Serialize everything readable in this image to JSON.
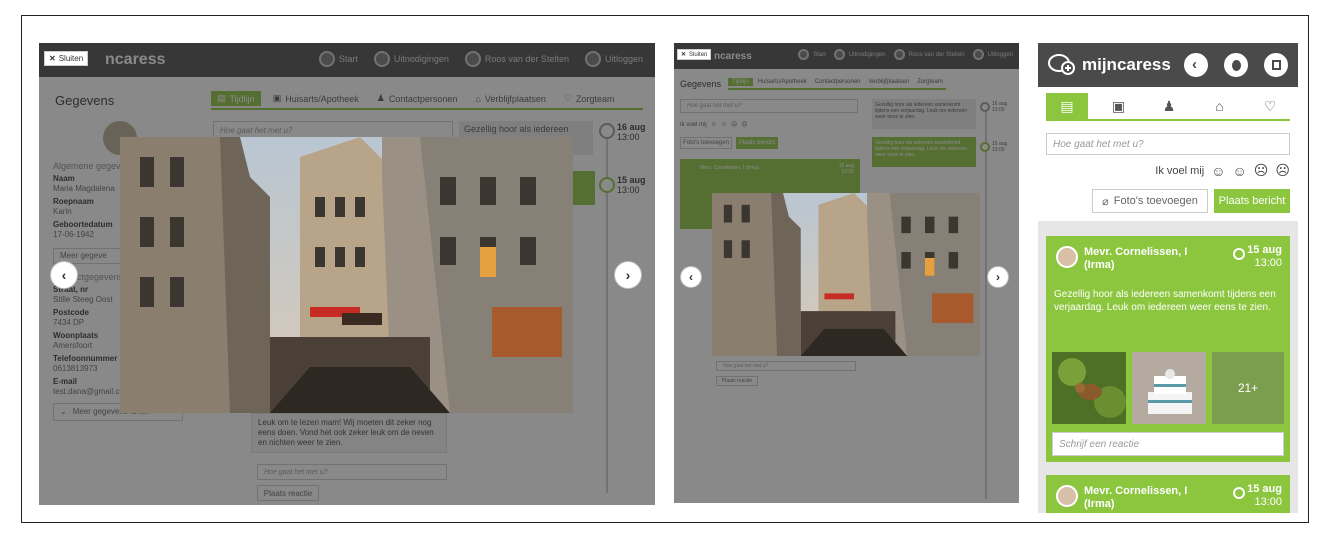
{
  "desktop": {
    "close_label": "Sluiten",
    "logo_fragment": "ncaress",
    "nav": [
      {
        "label": "Start",
        "icon": "back-icon"
      },
      {
        "label": "Uitnodigingen",
        "icon": "invite-icon"
      },
      {
        "label": "Roos van der Stelten",
        "icon": "user-icon"
      },
      {
        "label": "Uitloggen",
        "icon": "logout-icon"
      }
    ],
    "section_title": "Gegevens",
    "tabs": [
      {
        "label": "Tijdlijn",
        "icon": "timeline-icon",
        "active": true
      },
      {
        "label": "Huisarts/Apotheek",
        "icon": "hospital-icon",
        "active": false
      },
      {
        "label": "Contactpersonen",
        "icon": "contacts-icon",
        "active": false
      },
      {
        "label": "Verblijfplaatsen",
        "icon": "house-icon",
        "active": false
      },
      {
        "label": "Zorgteam",
        "icon": "team-icon",
        "active": false
      }
    ],
    "post_placeholder": "Hoe gaat het met u?",
    "timeline_bubble_1": "Gezellig hoor als iedereen",
    "timeline_date_1": {
      "day": "16 aug",
      "time": "13:00"
    },
    "timeline_date_2": {
      "day": "15 aug",
      "time": "13:00"
    },
    "profile": {
      "general_heading": "Algemene gegev",
      "fields": [
        {
          "label": "Naam",
          "value": "Maria Magdalena"
        },
        {
          "label": "Roepnaam",
          "value": "Karin"
        },
        {
          "label": "Geboortedatum",
          "value": "17-06-1942"
        }
      ],
      "more_button_fragment": "Meer gegeve",
      "contact_heading": "Contactgegevens",
      "contact_fields": [
        {
          "label": "Straat, nr",
          "value": "Stille Steeg Oost"
        },
        {
          "label": "Postcode",
          "value": "7434 DP"
        },
        {
          "label": "Woonplaats",
          "value": "Amersfoort"
        },
        {
          "label": "Telefoonnummer",
          "value": "0613813973"
        },
        {
          "label": "E-mail",
          "value": "test.dana@gmail.com"
        }
      ],
      "show_more_button": "Meer gegevens tonen"
    },
    "comment_text": "Leuk om te lezen mam! Wij moeten dit zeker nog eens doen. Vond het ook zeker leuk om de neven en nichten weer te zien.",
    "reply_placeholder": "Hoe gaat het met u?",
    "reply_button": "Plaats reactie"
  },
  "tablet": {
    "close_label": "Sluiten",
    "logo_fragment": "ncaress",
    "nav": [
      {
        "label": "Start"
      },
      {
        "label": "Uitnodigingen"
      },
      {
        "label": "Roos van der Stelten"
      },
      {
        "label": "Uitloggen"
      }
    ],
    "section_title": "Gegevens",
    "tabs": [
      {
        "label": "Tijdlijn",
        "active": true
      },
      {
        "label": "Huisarts/Apotheek",
        "active": false
      },
      {
        "label": "Contactpersonen",
        "active": false
      },
      {
        "label": "Verblijfplaatsen",
        "active": false
      },
      {
        "label": "Zorgteam",
        "active": false
      }
    ],
    "post_placeholder": "Hoe gaat het met u?",
    "feel_label": "Ik voel mij",
    "photo_button": "Foto's toevoegen",
    "post_button": "Plaats bericht",
    "post_author": "Mevr. Cornelissen, I (Irma)",
    "post_date": {
      "day": "15 aug",
      "time": "13:00"
    },
    "bubble_1": "Gezellig hoor als iedereen samenkomt tijdens een verjaardag. Leuk om iedereen weer eens te zien.",
    "bubble_2": "Gezellig hoor als iedereen samenkomt tijdens een verjaardag. Leuk om iedereen weer eens te zien.",
    "timeline_dates": [
      {
        "day": "16 aug",
        "time": "13:00"
      },
      {
        "day": "15 aug",
        "time": "13:00"
      }
    ],
    "reply_placeholder": "Hoe gaat het met u?",
    "reply_button": "Plaats reactie"
  },
  "mobile": {
    "logo": "mijncaress",
    "post_placeholder": "Hoe gaat het met u?",
    "feel_label": "Ik voel mij",
    "photo_button": "Foto's toevoegen",
    "post_button": "Plaats bericht",
    "post": {
      "author_line1": "Mevr. Cornelissen, I",
      "author_line2": "(Irma)",
      "day": "15 aug",
      "time": "13:00",
      "text": "Gezellig hoor als iedereen samenkomt tijdens een verjaardag. Leuk om iedereen weer eens te zien.",
      "more_photos": "21+",
      "reply_placeholder": "Schrijf een reactie"
    },
    "post2": {
      "author_line1": "Mevr. Cornelissen, I",
      "author_line2": "(Irma)",
      "day": "15 aug",
      "time": "13:00"
    }
  },
  "colors": {
    "accent": "#8cc63f",
    "topbar": "#4a4a4a",
    "overlay": "#2a2a2a"
  }
}
